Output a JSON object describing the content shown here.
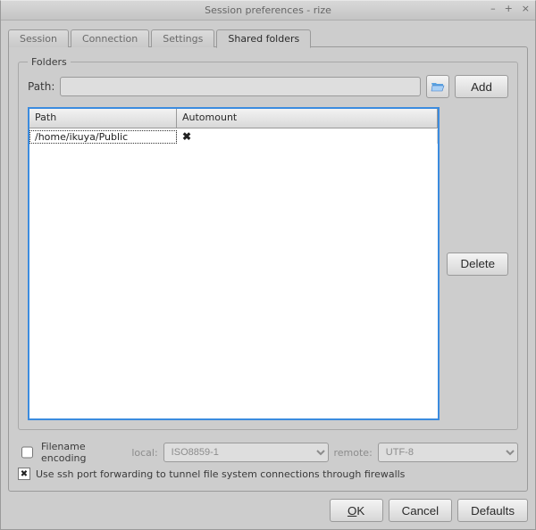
{
  "window": {
    "title": "Session preferences - rize"
  },
  "tabs": {
    "items": [
      {
        "label": "Session",
        "active": false
      },
      {
        "label": "Connection",
        "active": false
      },
      {
        "label": "Settings",
        "active": false
      },
      {
        "label": "Shared folders",
        "active": true
      }
    ]
  },
  "folders": {
    "legend": "Folders",
    "path_label": "Path:",
    "path_value": "",
    "add_label": "Add",
    "delete_label": "Delete",
    "columns": {
      "path": "Path",
      "automount": "Automount"
    },
    "rows": [
      {
        "path": "/home/ikuya/Public",
        "automount": false
      }
    ],
    "automount_off_glyph": "✖"
  },
  "encoding": {
    "enable_label": "Filename encoding",
    "enabled": false,
    "local_label": "local:",
    "local_value": "ISO8859-1",
    "remote_label": "remote:",
    "remote_value": "UTF-8"
  },
  "ssh": {
    "enabled": true,
    "label": "Use ssh port forwarding to tunnel file system connections through firewalls"
  },
  "buttons": {
    "ok": "OK",
    "cancel": "Cancel",
    "defaults": "Defaults"
  }
}
